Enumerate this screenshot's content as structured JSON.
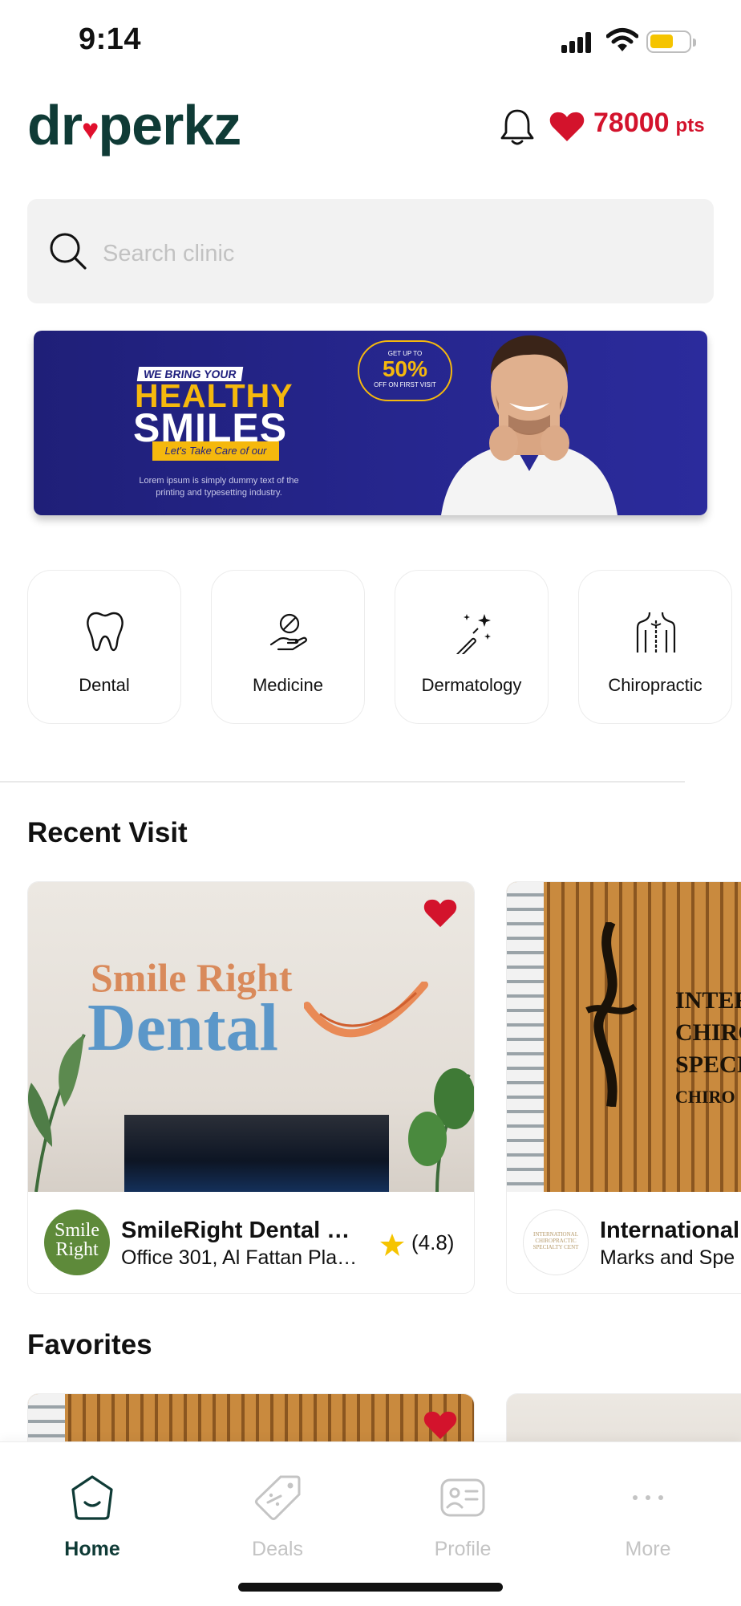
{
  "status_bar": {
    "time": "9:14"
  },
  "header": {
    "logo_text_left": "dr",
    "logo_text_right": "perkz",
    "points_value": "78000",
    "points_unit": "pts"
  },
  "search": {
    "placeholder": "Search clinic"
  },
  "banner": {
    "kicker": "WE BRING YOUR",
    "headline_1": "HEALTHY",
    "headline_2": "SMILES",
    "tagline": "Let's Take Care of our Teeth",
    "offer_top": "GET UP TO",
    "offer_percent": "50%",
    "offer_bottom": "OFF ON FIRST VISIT",
    "body": "Lorem ipsum is simply dummy text of the printing and typesetting industry."
  },
  "categories": [
    {
      "label": "Dental",
      "icon": "tooth-icon"
    },
    {
      "label": "Medicine",
      "icon": "pill-hand-icon"
    },
    {
      "label": "Dermatology",
      "icon": "magic-wand-icon"
    },
    {
      "label": "Chiropractic",
      "icon": "spine-body-icon"
    }
  ],
  "recent_visit": {
    "title": "Recent Visit",
    "cards": [
      {
        "photo_sign_line1": "Smile Right",
        "photo_sign_line2": "Dental",
        "avatar_text_1": "Smile",
        "avatar_text_2": "Right",
        "name": "SmileRight Dental C...",
        "address": "Office 301, Al Fattan Plaz...",
        "rating": "(4.8)",
        "favorited": true
      },
      {
        "photo_sign_lines": [
          "INTER",
          "CHIRO",
          "SPECIA",
          "CHIRO"
        ],
        "avatar_text_1": "INTERNATIONAL",
        "avatar_text_2": "CHIROPRACTIC",
        "avatar_text_3": "SPECIALTY CENT",
        "name": "International",
        "address": "Marks and Spe",
        "favorited": false
      }
    ]
  },
  "favorites": {
    "title": "Favorites"
  },
  "bottom_nav": [
    {
      "label": "Home",
      "icon": "home-icon",
      "active": true
    },
    {
      "label": "Deals",
      "icon": "tag-icon",
      "active": false
    },
    {
      "label": "Profile",
      "icon": "profile-card-icon",
      "active": false
    },
    {
      "label": "More",
      "icon": "more-dots-icon",
      "active": false
    }
  ],
  "colors": {
    "brand_dark_green": "#0f3b36",
    "accent_red": "#d3132c",
    "banner_blue": "#26268e",
    "banner_yellow": "#f5b80d",
    "star_yellow": "#f5c400"
  }
}
